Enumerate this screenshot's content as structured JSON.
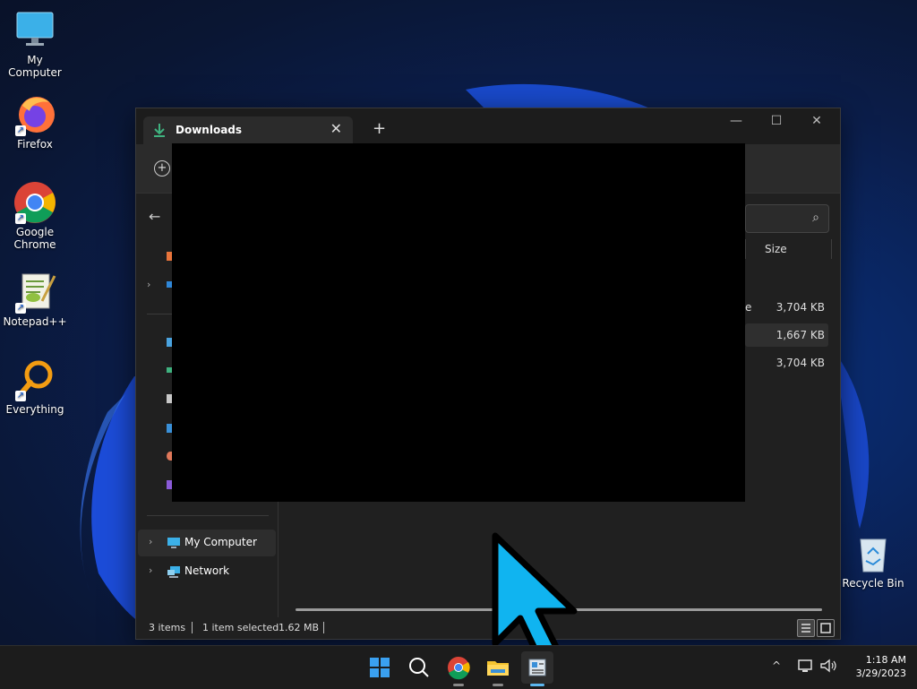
{
  "desktop": {
    "icons": [
      {
        "label": "My Computer",
        "icon": "monitor-icon"
      },
      {
        "label": "Firefox",
        "icon": "firefox-icon"
      },
      {
        "label": "Google\nChrome",
        "icon": "chrome-icon"
      },
      {
        "label": "Notepad++",
        "icon": "notepadpp-icon"
      },
      {
        "label": "Everything",
        "icon": "everything-search-icon"
      }
    ],
    "recycle_bin": {
      "label": "Recycle Bin",
      "icon": "recycle-bin-icon"
    }
  },
  "explorer": {
    "tab_title": "Downloads",
    "tab_close": "✕",
    "new_tab": "+",
    "window_controls": {
      "minimize": "—",
      "maximize": "☐",
      "close": "✕"
    },
    "toolbar_new": "+",
    "back": "←",
    "search_icon": "⌕",
    "columns": {
      "size": "Size"
    },
    "rows": [
      {
        "name_fragment": "e",
        "size": "3,704 KB",
        "selected": false
      },
      {
        "name_fragment": "",
        "size": "1,667 KB",
        "selected": true
      },
      {
        "name_fragment": "",
        "size": "3,704 KB",
        "selected": false
      }
    ],
    "sidebar": {
      "my_computer": "My Computer",
      "network": "Network"
    },
    "status": {
      "items": "3 items",
      "selected": "1 item selected",
      "size": "1.62 MB"
    }
  },
  "taskbar": {
    "apps": [
      "start-icon",
      "search-icon",
      "chrome-icon",
      "file-explorer-icon",
      "active-app-icon"
    ],
    "tray_chevron": "^",
    "clock": {
      "time": "1:18 AM",
      "date": "3/29/2023"
    }
  },
  "colors": {
    "accent": "#5cb7f0",
    "cursor": "#10b4f0"
  }
}
